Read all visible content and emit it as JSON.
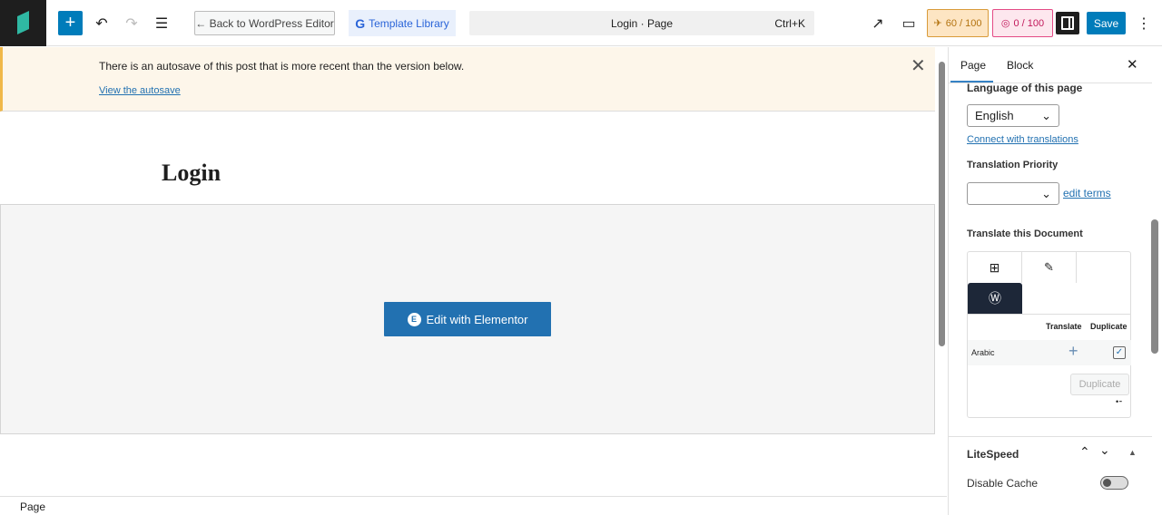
{
  "toolbar": {
    "back_label": "← Back to WordPress Editor",
    "template_library": "Template Library",
    "command_title": "Login · Page",
    "command_shortcut": "Ctrl+K",
    "score_seo": "60 / 100",
    "score_readability": "0 / 100",
    "save_label": "Save"
  },
  "notice": {
    "message": "There is an autosave of this post that is more recent than the version below.",
    "link": "View the autosave"
  },
  "canvas": {
    "title": "Login",
    "elementor_button": "Edit with Elementor"
  },
  "statusbar": {
    "breadcrumb": "Page"
  },
  "panel": {
    "tabs": [
      "Page",
      "Block"
    ],
    "language_label": "Language of this page",
    "language_value": "English",
    "connect_link": "Connect with translations",
    "priority_label": "Translation Priority",
    "priority_value": "",
    "edit_terms": "edit terms",
    "translate_doc_label": "Translate this Document",
    "table_headers": [
      "Translate",
      "Duplicate"
    ],
    "rows": [
      {
        "language": "Arabic",
        "duplicate_checked": true
      }
    ],
    "duplicate_button": "Duplicate",
    "litespeed_label": "LiteSpeed",
    "disable_cache_label": "Disable Cache",
    "disable_cache_on": false
  }
}
